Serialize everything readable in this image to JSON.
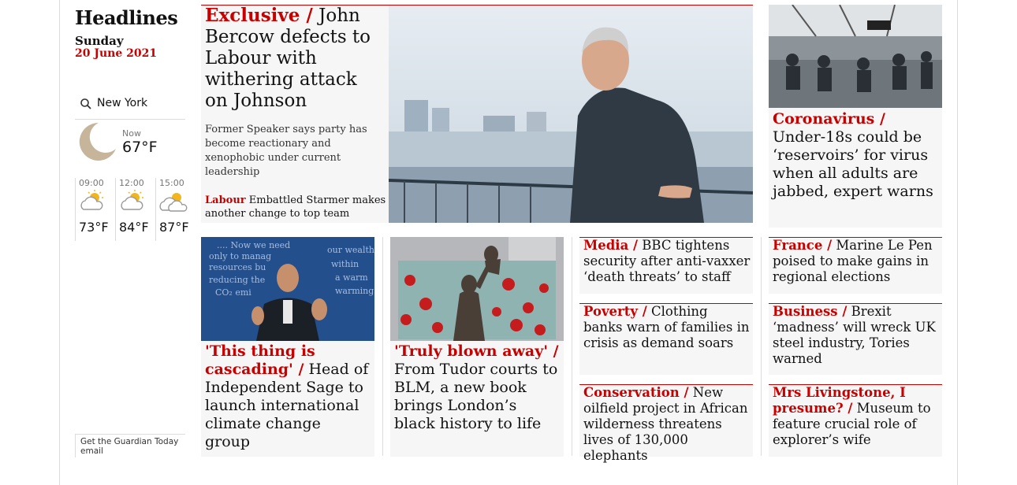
{
  "header": {
    "title": "Headlines",
    "day": "Sunday",
    "date": "20 June 2021"
  },
  "weather": {
    "location": "New York",
    "now_label": "Now",
    "now_temp": "67°F",
    "forecast": [
      {
        "time": "09:00",
        "temp": "73°F",
        "icon": "partly-cloudy-icon"
      },
      {
        "time": "12:00",
        "temp": "84°F",
        "icon": "partly-cloudy-icon"
      },
      {
        "time": "15:00",
        "temp": "87°F",
        "icon": "partly-cloudy-icon"
      }
    ],
    "cta": "Get the Guardian Today email"
  },
  "lead": {
    "kicker": "Exclusive /",
    "headline": " John Bercow defects to Labour with withering attack on Johnson",
    "standfirst": "Former Speaker says party has become reactionary and xenophobic under current leadership",
    "sub_kicker": "Labour",
    "sub_headline": " Embattled Starmer makes another change to top team"
  },
  "right_top": {
    "kicker": "Coronavirus /",
    "headline": " Under-18s could be ‘reservoirs’ for virus when all adults are jabbed, expert warns"
  },
  "bottom_cards": [
    {
      "kicker": "'This thing is cascading' /",
      "headline": " Head of Independent Sage to launch international climate change group"
    },
    {
      "kicker": "'Truly blown away' /",
      "headline": " From Tudor courts to BLM, a new book brings London’s black history to life"
    }
  ],
  "small_cards": [
    {
      "kicker": "Media /",
      "headline": " BBC tightens security after anti-vaxxer ‘death threats’ to staff"
    },
    {
      "kicker": "France /",
      "headline": " Marine Le Pen poised to make gains in regional elections"
    },
    {
      "kicker": "Poverty /",
      "headline": " Clothing banks warn of families in crisis as demand soars"
    },
    {
      "kicker": "Business /",
      "headline": " Brexit ‘madness’ will wreck UK steel industry, Tories warned"
    },
    {
      "kicker": "Conservation /",
      "headline": " New oilfield project in African wilderness threatens lives of 130,000 elephants"
    },
    {
      "kicker": "Mrs Livingstone, I presume? /",
      "headline": " Museum to feature crucial role of explorer’s wife"
    }
  ],
  "colors": {
    "accent": "#c70000",
    "card_bg": "#f6f6f6"
  }
}
